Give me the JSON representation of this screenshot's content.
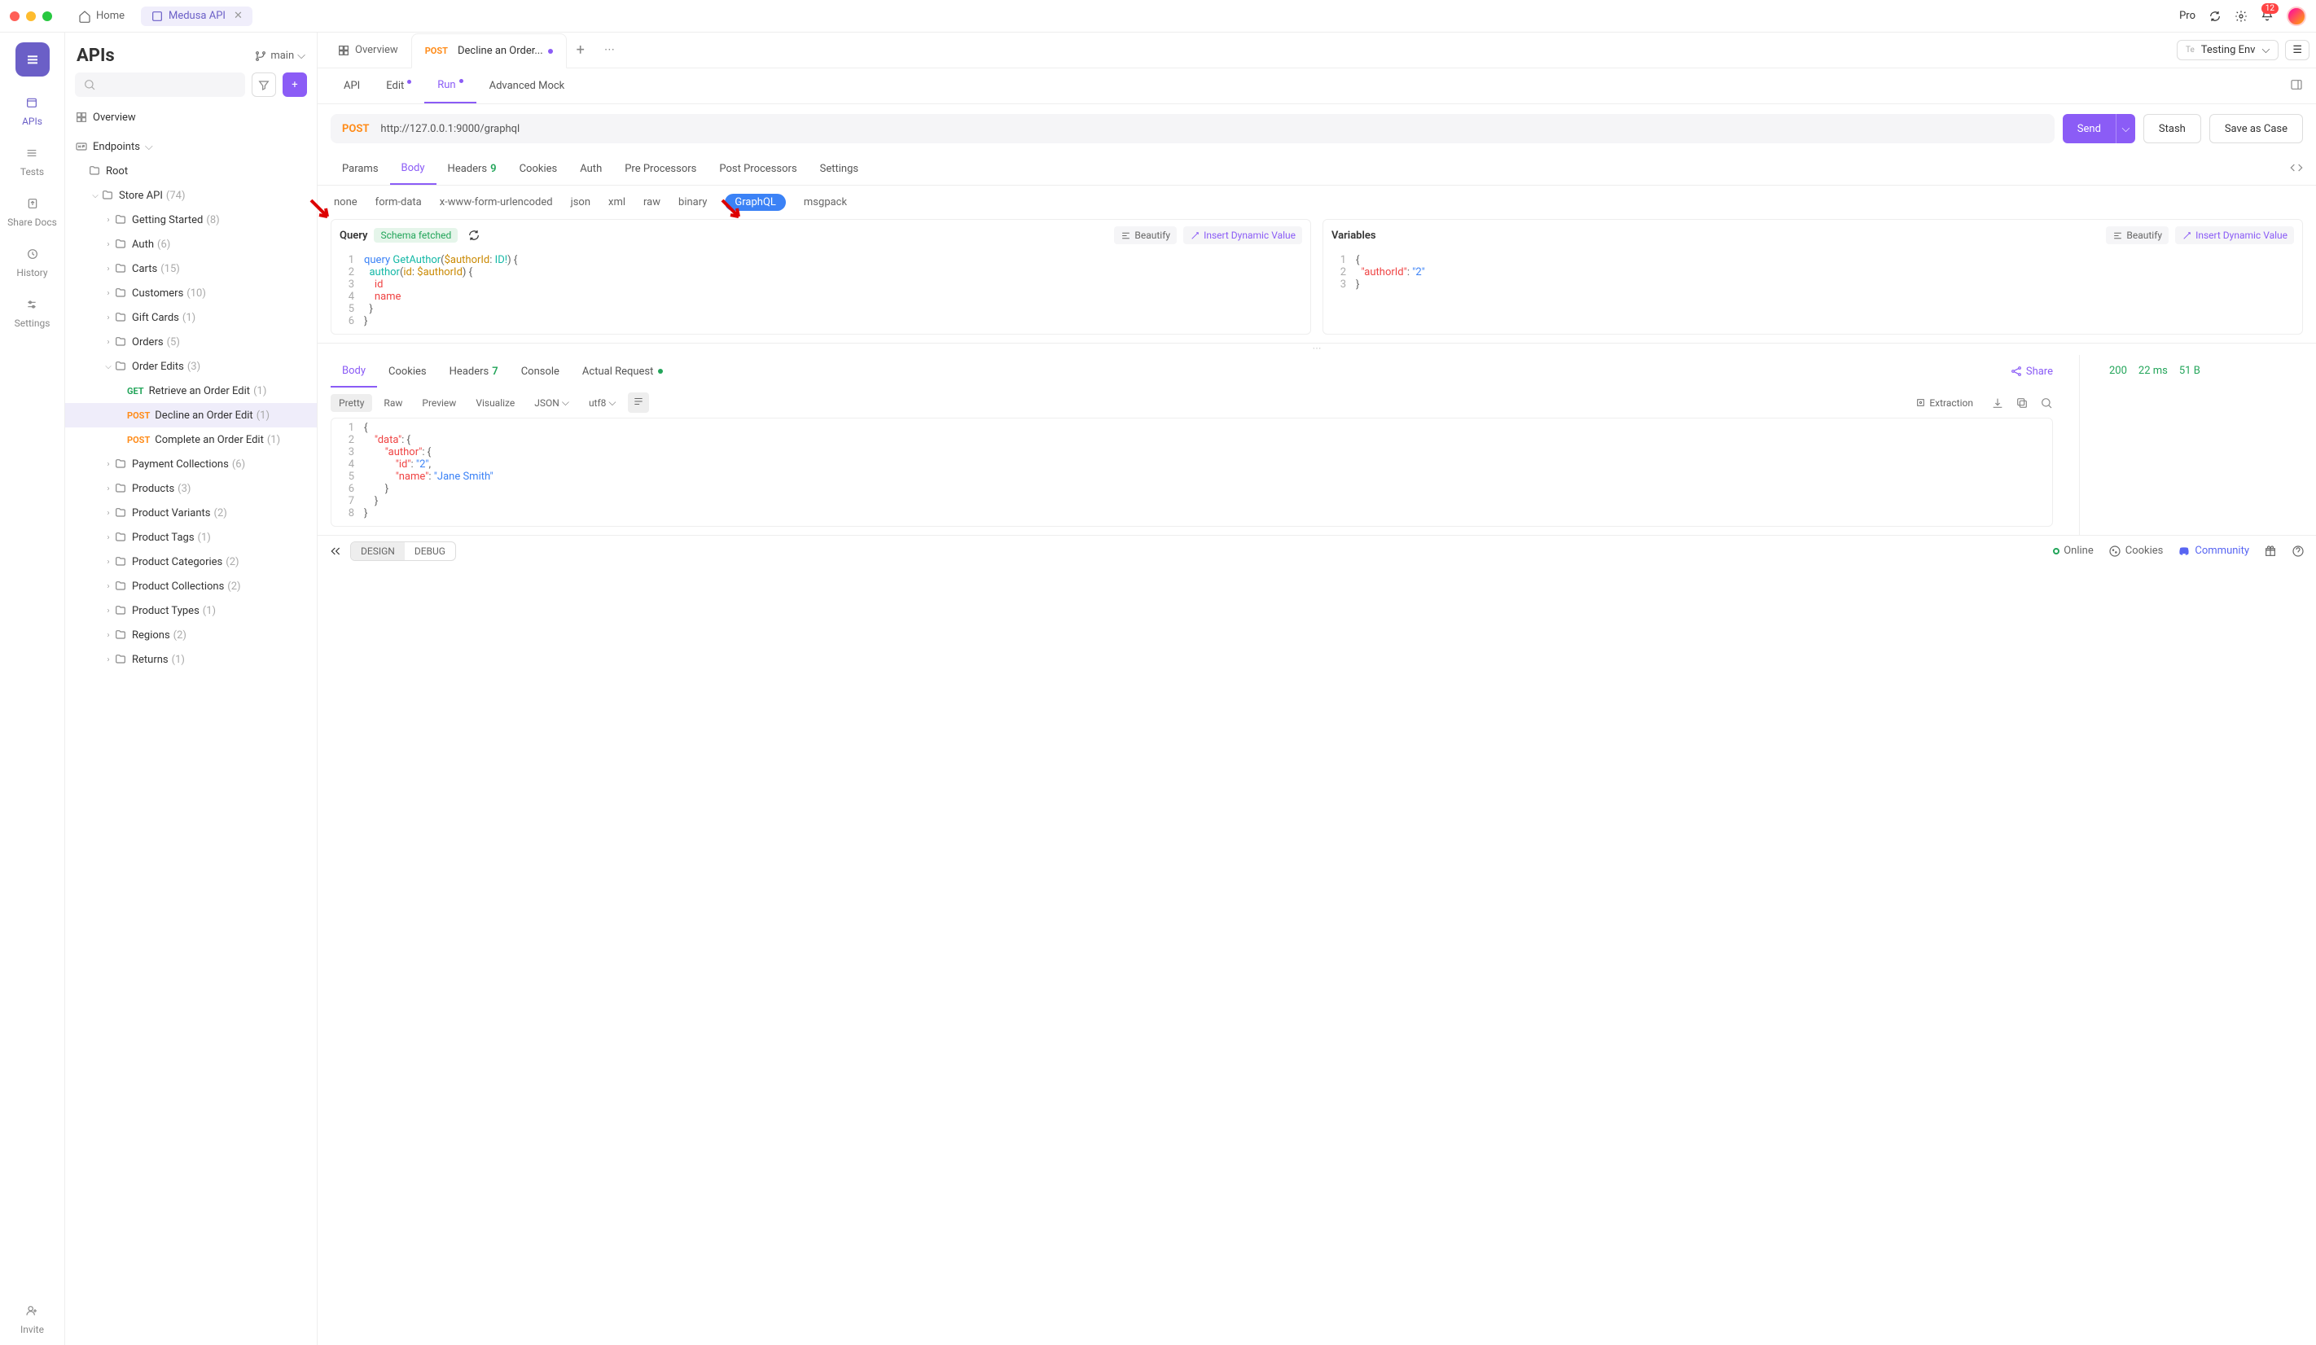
{
  "titlebar": {
    "home": "Home",
    "api_tab": "Medusa API",
    "pro": "Pro",
    "notif_count": "12"
  },
  "rail": {
    "apis": "APIs",
    "tests": "Tests",
    "share": "Share Docs",
    "history": "History",
    "settings": "Settings",
    "invite": "Invite"
  },
  "sidebar": {
    "title": "APIs",
    "branch": "main",
    "overview": "Overview",
    "endpoints": "Endpoints",
    "tree": [
      {
        "indent": 0,
        "chev": "",
        "icon": "folder",
        "label": "Root",
        "count": ""
      },
      {
        "indent": 1,
        "chev": "v",
        "icon": "folder",
        "label": "Store API",
        "count": "(74)"
      },
      {
        "indent": 2,
        "chev": ">",
        "icon": "folder",
        "label": "Getting Started",
        "count": "(8)"
      },
      {
        "indent": 2,
        "chev": ">",
        "icon": "folder",
        "label": "Auth",
        "count": "(6)"
      },
      {
        "indent": 2,
        "chev": ">",
        "icon": "folder",
        "label": "Carts",
        "count": "(15)"
      },
      {
        "indent": 2,
        "chev": ">",
        "icon": "folder",
        "label": "Customers",
        "count": "(10)"
      },
      {
        "indent": 2,
        "chev": ">",
        "icon": "folder",
        "label": "Gift Cards",
        "count": "(1)"
      },
      {
        "indent": 2,
        "chev": ">",
        "icon": "folder",
        "label": "Orders",
        "count": "(5)"
      },
      {
        "indent": 2,
        "chev": "v",
        "icon": "folder",
        "label": "Order Edits",
        "count": "(3)"
      },
      {
        "indent": 3,
        "chev": "",
        "method": "GET",
        "label": "Retrieve an Order Edit",
        "count": "(1)"
      },
      {
        "indent": 3,
        "chev": "",
        "method": "POST",
        "label": "Decline an Order Edit",
        "count": "(1)",
        "selected": true
      },
      {
        "indent": 3,
        "chev": "",
        "method": "POST",
        "label": "Complete an Order Edit",
        "count": "(1)"
      },
      {
        "indent": 2,
        "chev": ">",
        "icon": "folder",
        "label": "Payment Collections",
        "count": "(6)"
      },
      {
        "indent": 2,
        "chev": ">",
        "icon": "folder",
        "label": "Products",
        "count": "(3)"
      },
      {
        "indent": 2,
        "chev": ">",
        "icon": "folder",
        "label": "Product Variants",
        "count": "(2)"
      },
      {
        "indent": 2,
        "chev": ">",
        "icon": "folder",
        "label": "Product Tags",
        "count": "(1)"
      },
      {
        "indent": 2,
        "chev": ">",
        "icon": "folder",
        "label": "Product Categories",
        "count": "(2)"
      },
      {
        "indent": 2,
        "chev": ">",
        "icon": "folder",
        "label": "Product Collections",
        "count": "(2)"
      },
      {
        "indent": 2,
        "chev": ">",
        "icon": "folder",
        "label": "Product Types",
        "count": "(1)"
      },
      {
        "indent": 2,
        "chev": ">",
        "icon": "folder",
        "label": "Regions",
        "count": "(2)"
      },
      {
        "indent": 2,
        "chev": ">",
        "icon": "folder",
        "label": "Returns",
        "count": "(1)"
      }
    ]
  },
  "content_tabs": {
    "overview": "Overview",
    "active_method": "POST",
    "active_label": "Decline an Order..."
  },
  "env": {
    "prefix": "Te",
    "name": "Testing Env"
  },
  "subtabs": {
    "api": "API",
    "edit": "Edit",
    "run": "Run",
    "mock": "Advanced Mock"
  },
  "url": {
    "method": "POST",
    "value": "http://127.0.0.1:9000/graphql"
  },
  "actions": {
    "send": "Send",
    "stash": "Stash",
    "save": "Save as Case"
  },
  "reqtabs": {
    "params": "Params",
    "body": "Body",
    "headers": "Headers",
    "headers_count": "9",
    "cookies": "Cookies",
    "auth": "Auth",
    "pre": "Pre Processors",
    "post": "Post Processors",
    "settings": "Settings"
  },
  "bodytypes": {
    "none": "none",
    "form": "form-data",
    "xwww": "x-www-form-urlencoded",
    "json": "json",
    "xml": "xml",
    "raw": "raw",
    "binary": "binary",
    "graphql": "GraphQL",
    "msgpack": "msgpack"
  },
  "query": {
    "title": "Query",
    "schema": "Schema fetched",
    "beautify": "Beautify",
    "dynamic": "Insert Dynamic Value",
    "lines": [
      {
        "n": "1",
        "html": "<span class='kw'>query</span> <span class='fn'>GetAuthor</span><span class='punc'>(</span><span class='var'>$authorId</span><span class='punc'>: </span><span class='fn'>ID!</span><span class='punc'>) {</span>"
      },
      {
        "n": "2",
        "html": "  <span class='fn'>author</span><span class='punc'>(</span><span class='var'>id</span><span class='punc'>: </span><span class='var'>$authorId</span><span class='punc'>) {</span>"
      },
      {
        "n": "3",
        "html": "    <span class='prop'>id</span>"
      },
      {
        "n": "4",
        "html": "    <span class='prop'>name</span>"
      },
      {
        "n": "5",
        "html": "  <span class='punc'>}</span>"
      },
      {
        "n": "6",
        "html": "<span class='punc'>}</span>"
      }
    ]
  },
  "variables": {
    "title": "Variables",
    "beautify": "Beautify",
    "dynamic": "Insert Dynamic Value",
    "lines": [
      {
        "n": "1",
        "html": "<span class='punc'>{</span>"
      },
      {
        "n": "2",
        "html": "  <span class='prop'>\"authorId\"</span><span class='punc'>: </span><span class='str'>\"2\"</span>"
      },
      {
        "n": "3",
        "html": "<span class='punc'>}</span>"
      }
    ]
  },
  "resptabs": {
    "body": "Body",
    "cookies": "Cookies",
    "headers": "Headers",
    "headers_count": "7",
    "console": "Console",
    "actual": "Actual Request",
    "share": "Share"
  },
  "stats": {
    "code": "200",
    "time": "22 ms",
    "size": "51 B"
  },
  "view": {
    "pretty": "Pretty",
    "raw": "Raw",
    "preview": "Preview",
    "visualize": "Visualize",
    "json": "JSON",
    "utf8": "utf8",
    "extraction": "Extraction"
  },
  "resp_body": {
    "lines": [
      {
        "n": "1",
        "html": "<span class='punc'>{</span>"
      },
      {
        "n": "2",
        "html": "    <span class='prop'>\"data\"</span><span class='punc'>: {</span>"
      },
      {
        "n": "3",
        "html": "        <span class='prop'>\"author\"</span><span class='punc'>: {</span>"
      },
      {
        "n": "4",
        "html": "            <span class='prop'>\"id\"</span><span class='punc'>: </span><span class='str'>\"2\"</span><span class='punc'>,</span>"
      },
      {
        "n": "5",
        "html": "            <span class='prop'>\"name\"</span><span class='punc'>: </span><span class='str'>\"Jane Smith\"</span>"
      },
      {
        "n": "6",
        "html": "        <span class='punc'>}</span>"
      },
      {
        "n": "7",
        "html": "    <span class='punc'>}</span>"
      },
      {
        "n": "8",
        "html": "<span class='punc'>}</span>"
      }
    ]
  },
  "footer": {
    "design": "DESIGN",
    "debug": "DEBUG",
    "online": "Online",
    "cookies": "Cookies",
    "community": "Community"
  }
}
